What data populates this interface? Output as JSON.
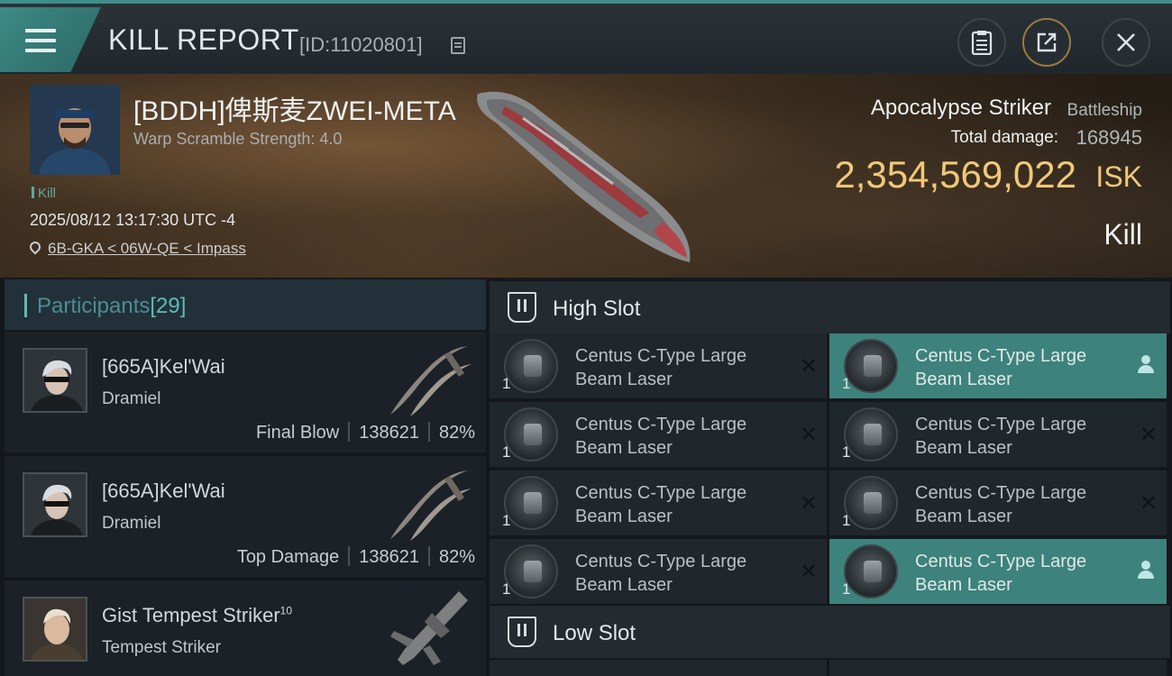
{
  "header": {
    "title": "KILL REPORT",
    "report_id": "[ID:11020801]",
    "icons": [
      "menu-icon",
      "copy-icon",
      "clipboard-icon",
      "share-icon",
      "close-icon"
    ]
  },
  "victim": {
    "pilot_name": "[BDDH]俾斯麦ZWEI-META",
    "warp_scramble": "Warp Scramble Strength: 4.0",
    "tag": "Kill",
    "datetime": "2025/08/12 13:17:30 UTC -4",
    "location": "6B-GKA < 06W-QE < Impass",
    "ship_name": "Apocalypse Striker",
    "ship_class": "Battleship",
    "total_damage_label": "Total damage:",
    "total_damage": "168945",
    "isk_value": "2,354,569,022",
    "isk_unit": "ISK",
    "result": "Kill"
  },
  "participants": {
    "label": "Participants",
    "count": "[29]",
    "items": [
      {
        "name": "[665A]Kel'Wai",
        "ship": "Dramiel",
        "role": "Final Blow",
        "damage": "138621",
        "percent": "82%"
      },
      {
        "name": "[665A]Kel'Wai",
        "ship": "Dramiel",
        "role": "Top Damage",
        "damage": "138621",
        "percent": "82%"
      },
      {
        "name": "Gist Tempest Striker",
        "level": "10",
        "ship": "Tempest Striker"
      }
    ]
  },
  "slots": {
    "high_label": "High Slot",
    "low_label": "Low Slot",
    "modules": [
      {
        "name": "Centus C-Type Large Beam Laser",
        "qty": "1",
        "status": "destroyed"
      },
      {
        "name": "Centus C-Type Large Beam Laser",
        "qty": "1",
        "status": "dropped"
      },
      {
        "name": "Centus C-Type Large Beam Laser",
        "qty": "1",
        "status": "destroyed"
      },
      {
        "name": "Centus C-Type Large Beam Laser",
        "qty": "1",
        "status": "destroyed"
      },
      {
        "name": "Centus C-Type Large Beam Laser",
        "qty": "1",
        "status": "destroyed"
      },
      {
        "name": "Centus C-Type Large Beam Laser",
        "qty": "1",
        "status": "destroyed"
      },
      {
        "name": "Centus C-Type Large Beam Laser",
        "qty": "1",
        "status": "destroyed"
      },
      {
        "name": "Centus C-Type Large Beam Laser",
        "qty": "1",
        "status": "dropped"
      }
    ]
  },
  "colors": {
    "accent": "#3d827c",
    "isk": "#f0c878",
    "panel": "#20272c"
  }
}
